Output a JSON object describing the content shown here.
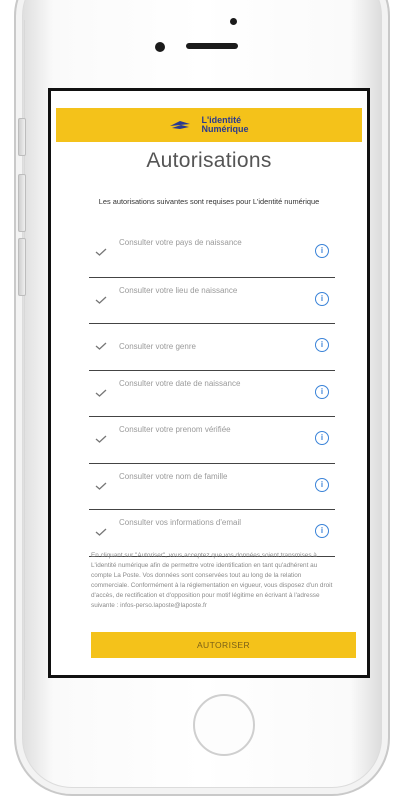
{
  "header": {
    "logo_line1": "L'identité",
    "logo_line2": "Numérique",
    "brand_color": "#f4c21a",
    "brand_text_color": "#2a3a8f"
  },
  "page": {
    "title": "Autorisations",
    "intro": "Les autorisations suivantes sont requises pour L'identité numérique"
  },
  "permissions": [
    {
      "label": "Consulter votre pays de naissance",
      "check_icon": "checkmark-icon",
      "info_icon": "info-icon"
    },
    {
      "label": "Consulter votre lieu de naissance",
      "check_icon": "checkmark-icon",
      "info_icon": "info-icon"
    },
    {
      "label": "Consulter votre genre",
      "check_icon": "checkmark-icon",
      "info_icon": "info-icon"
    },
    {
      "label": "Consulter votre date de naissance",
      "check_icon": "checkmark-icon",
      "info_icon": "info-icon"
    },
    {
      "label": "Consulter votre prenom vérifiée",
      "check_icon": "checkmark-icon",
      "info_icon": "info-icon"
    },
    {
      "label": "Consulter votre nom de famille",
      "check_icon": "checkmark-icon",
      "info_icon": "info-icon"
    },
    {
      "label": "Consulter vos informations d'email",
      "check_icon": "checkmark-icon",
      "info_icon": "info-icon"
    }
  ],
  "legal_text": "En cliquant sur \"Autoriser\", vous acceptez que vos données soient transmises à L'identité numérique afin de permettre votre identification en tant qu'adhérent au compte La Poste. Vos données sont conservées tout au long de la relation commerciale. Conformément à la réglementation en vigueur, vous disposez d'un droit d'accès, de rectification et d'opposition pour motif légitime en écrivant à l'adresse suivante : infos-perso.laposte@laposte.fr",
  "actions": {
    "authorize_label": "AUTORISER"
  },
  "info_icon_color": "#3a83d8"
}
